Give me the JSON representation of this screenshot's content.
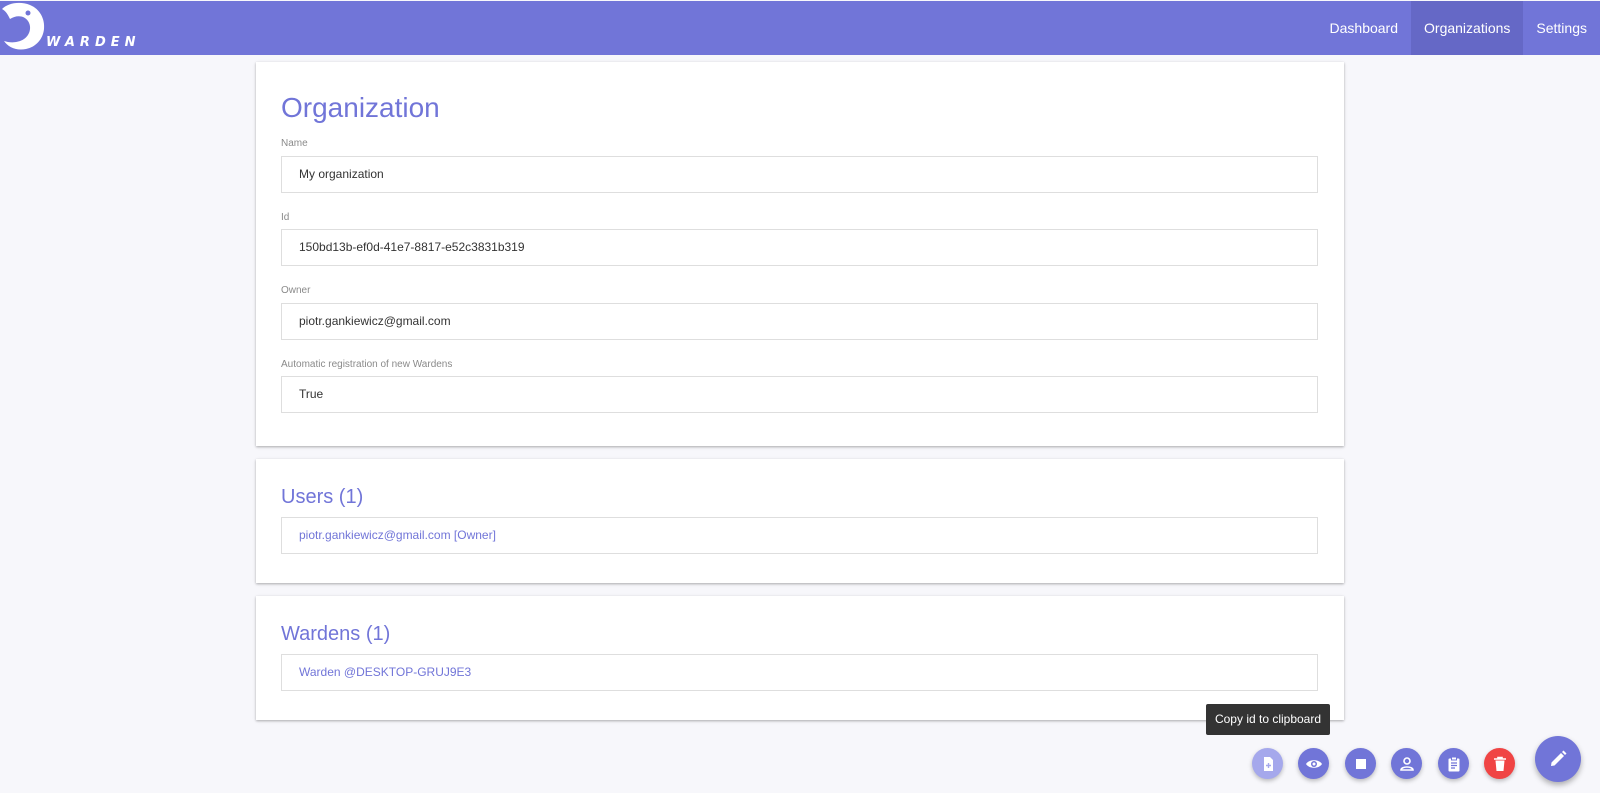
{
  "brand": {
    "name": "WARDEN"
  },
  "nav": {
    "items": [
      {
        "label": "Dashboard"
      },
      {
        "label": "Organizations"
      },
      {
        "label": "Settings"
      }
    ]
  },
  "organization": {
    "title": "Organization",
    "fields": {
      "name": {
        "label": "Name",
        "value": "My organization"
      },
      "id": {
        "label": "Id",
        "value": "150bd13b-ef0d-41e7-8817-e52c3831b319"
      },
      "owner": {
        "label": "Owner",
        "value": "piotr.gankiewicz@gmail.com"
      },
      "auto_registration": {
        "label": "Automatic registration of new Wardens",
        "value": "True"
      }
    }
  },
  "users": {
    "title": "Users (1)",
    "items": [
      {
        "label": "piotr.gankiewicz@gmail.com [Owner]"
      }
    ]
  },
  "wardens": {
    "title": "Wardens (1)",
    "items": [
      {
        "label": "Warden @DESKTOP-GRUJ9E3"
      }
    ]
  },
  "tooltip": {
    "text": "Copy id to clipboard"
  },
  "actions": [
    {
      "icon": "file-plus-icon"
    },
    {
      "icon": "eye-icon"
    },
    {
      "icon": "stop-icon"
    },
    {
      "icon": "person-icon"
    },
    {
      "icon": "clipboard-icon"
    },
    {
      "icon": "trash-icon"
    },
    {
      "icon": "pencil-icon"
    }
  ],
  "colors": {
    "accent": "#7175d8",
    "accent_dark": "#6568c6",
    "danger": "#f04444",
    "background": "#f7f7fb"
  }
}
